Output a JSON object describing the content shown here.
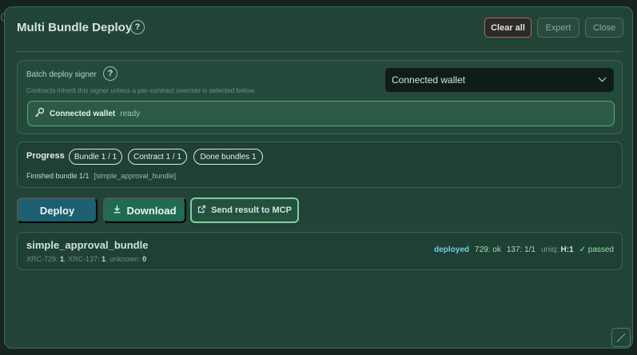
{
  "modal": {
    "title": "Multi Bundle Deploy",
    "help_glyph": "?",
    "buttons": {
      "clear_all": "Clear all",
      "expert": "Expert",
      "close": "Close"
    }
  },
  "signer": {
    "label": "Batch deploy signer",
    "help_glyph": "?",
    "hint": "Contracts inherit this signer unless a per-contract override is selected below.",
    "selected": "Connected wallet",
    "status_name": "Connected wallet",
    "status_state": "ready"
  },
  "progress": {
    "label": "Progress",
    "pills": [
      "Bundle 1 / 1",
      "Contract 1 / 1",
      "Done bundles 1"
    ],
    "status_text": "Finished bundle 1/1",
    "status_tag": "[simple_approval_bundle]"
  },
  "actions": {
    "deploy": "Deploy",
    "download": "Download",
    "send_mcp": "Send result to MCP"
  },
  "result": {
    "name": "simple_approval_bundle",
    "counts": [
      {
        "label": "XRC-729:",
        "value": "1"
      },
      {
        "label": "XRC-137:",
        "value": "1"
      },
      {
        "label": "unknown:",
        "value": "0"
      }
    ],
    "state": "deployed",
    "ok_729": "729: ok",
    "ok_137": "137: 1/1",
    "uniq_label": "uniq:",
    "uniq_value": "H:1",
    "passed": "✓ passed"
  },
  "icons": {
    "key": "key-icon",
    "download": "download-icon",
    "external": "external-link-icon",
    "chevron": "chevron-down-icon"
  },
  "colors": {
    "accent_teal": "#1d6070",
    "accent_green": "#1f6b53",
    "success": "#8fe0a8",
    "danger_border": "#b06a5e"
  }
}
